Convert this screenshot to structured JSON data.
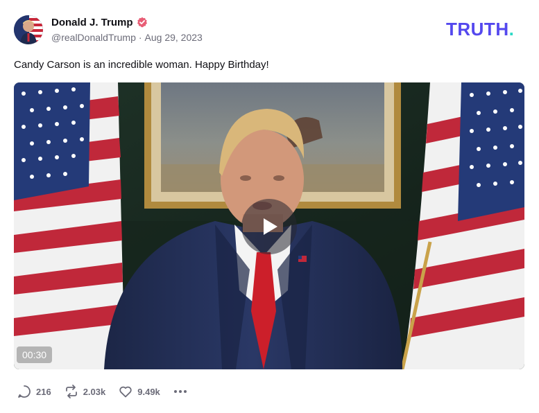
{
  "author": {
    "display_name": "Donald J. Trump",
    "handle": "@realDonaldTrump",
    "separator": "·",
    "date": "Aug 29, 2023",
    "verified_icon": "verified-badge-icon"
  },
  "brand": {
    "text": "TRUTH",
    "dot": ".",
    "color": "#5448ee",
    "dot_color": "#2bd9c6"
  },
  "post": {
    "text": "Candy Carson is an incredible woman. Happy Birthday!"
  },
  "video": {
    "duration": "00:30",
    "play_icon": "play-icon"
  },
  "actions": {
    "replies": "216",
    "retruths": "2.03k",
    "likes": "9.49k",
    "more_icon": "more-icon"
  },
  "colors": {
    "text_secondary": "#6b6b78",
    "verified": "#e85d75"
  }
}
